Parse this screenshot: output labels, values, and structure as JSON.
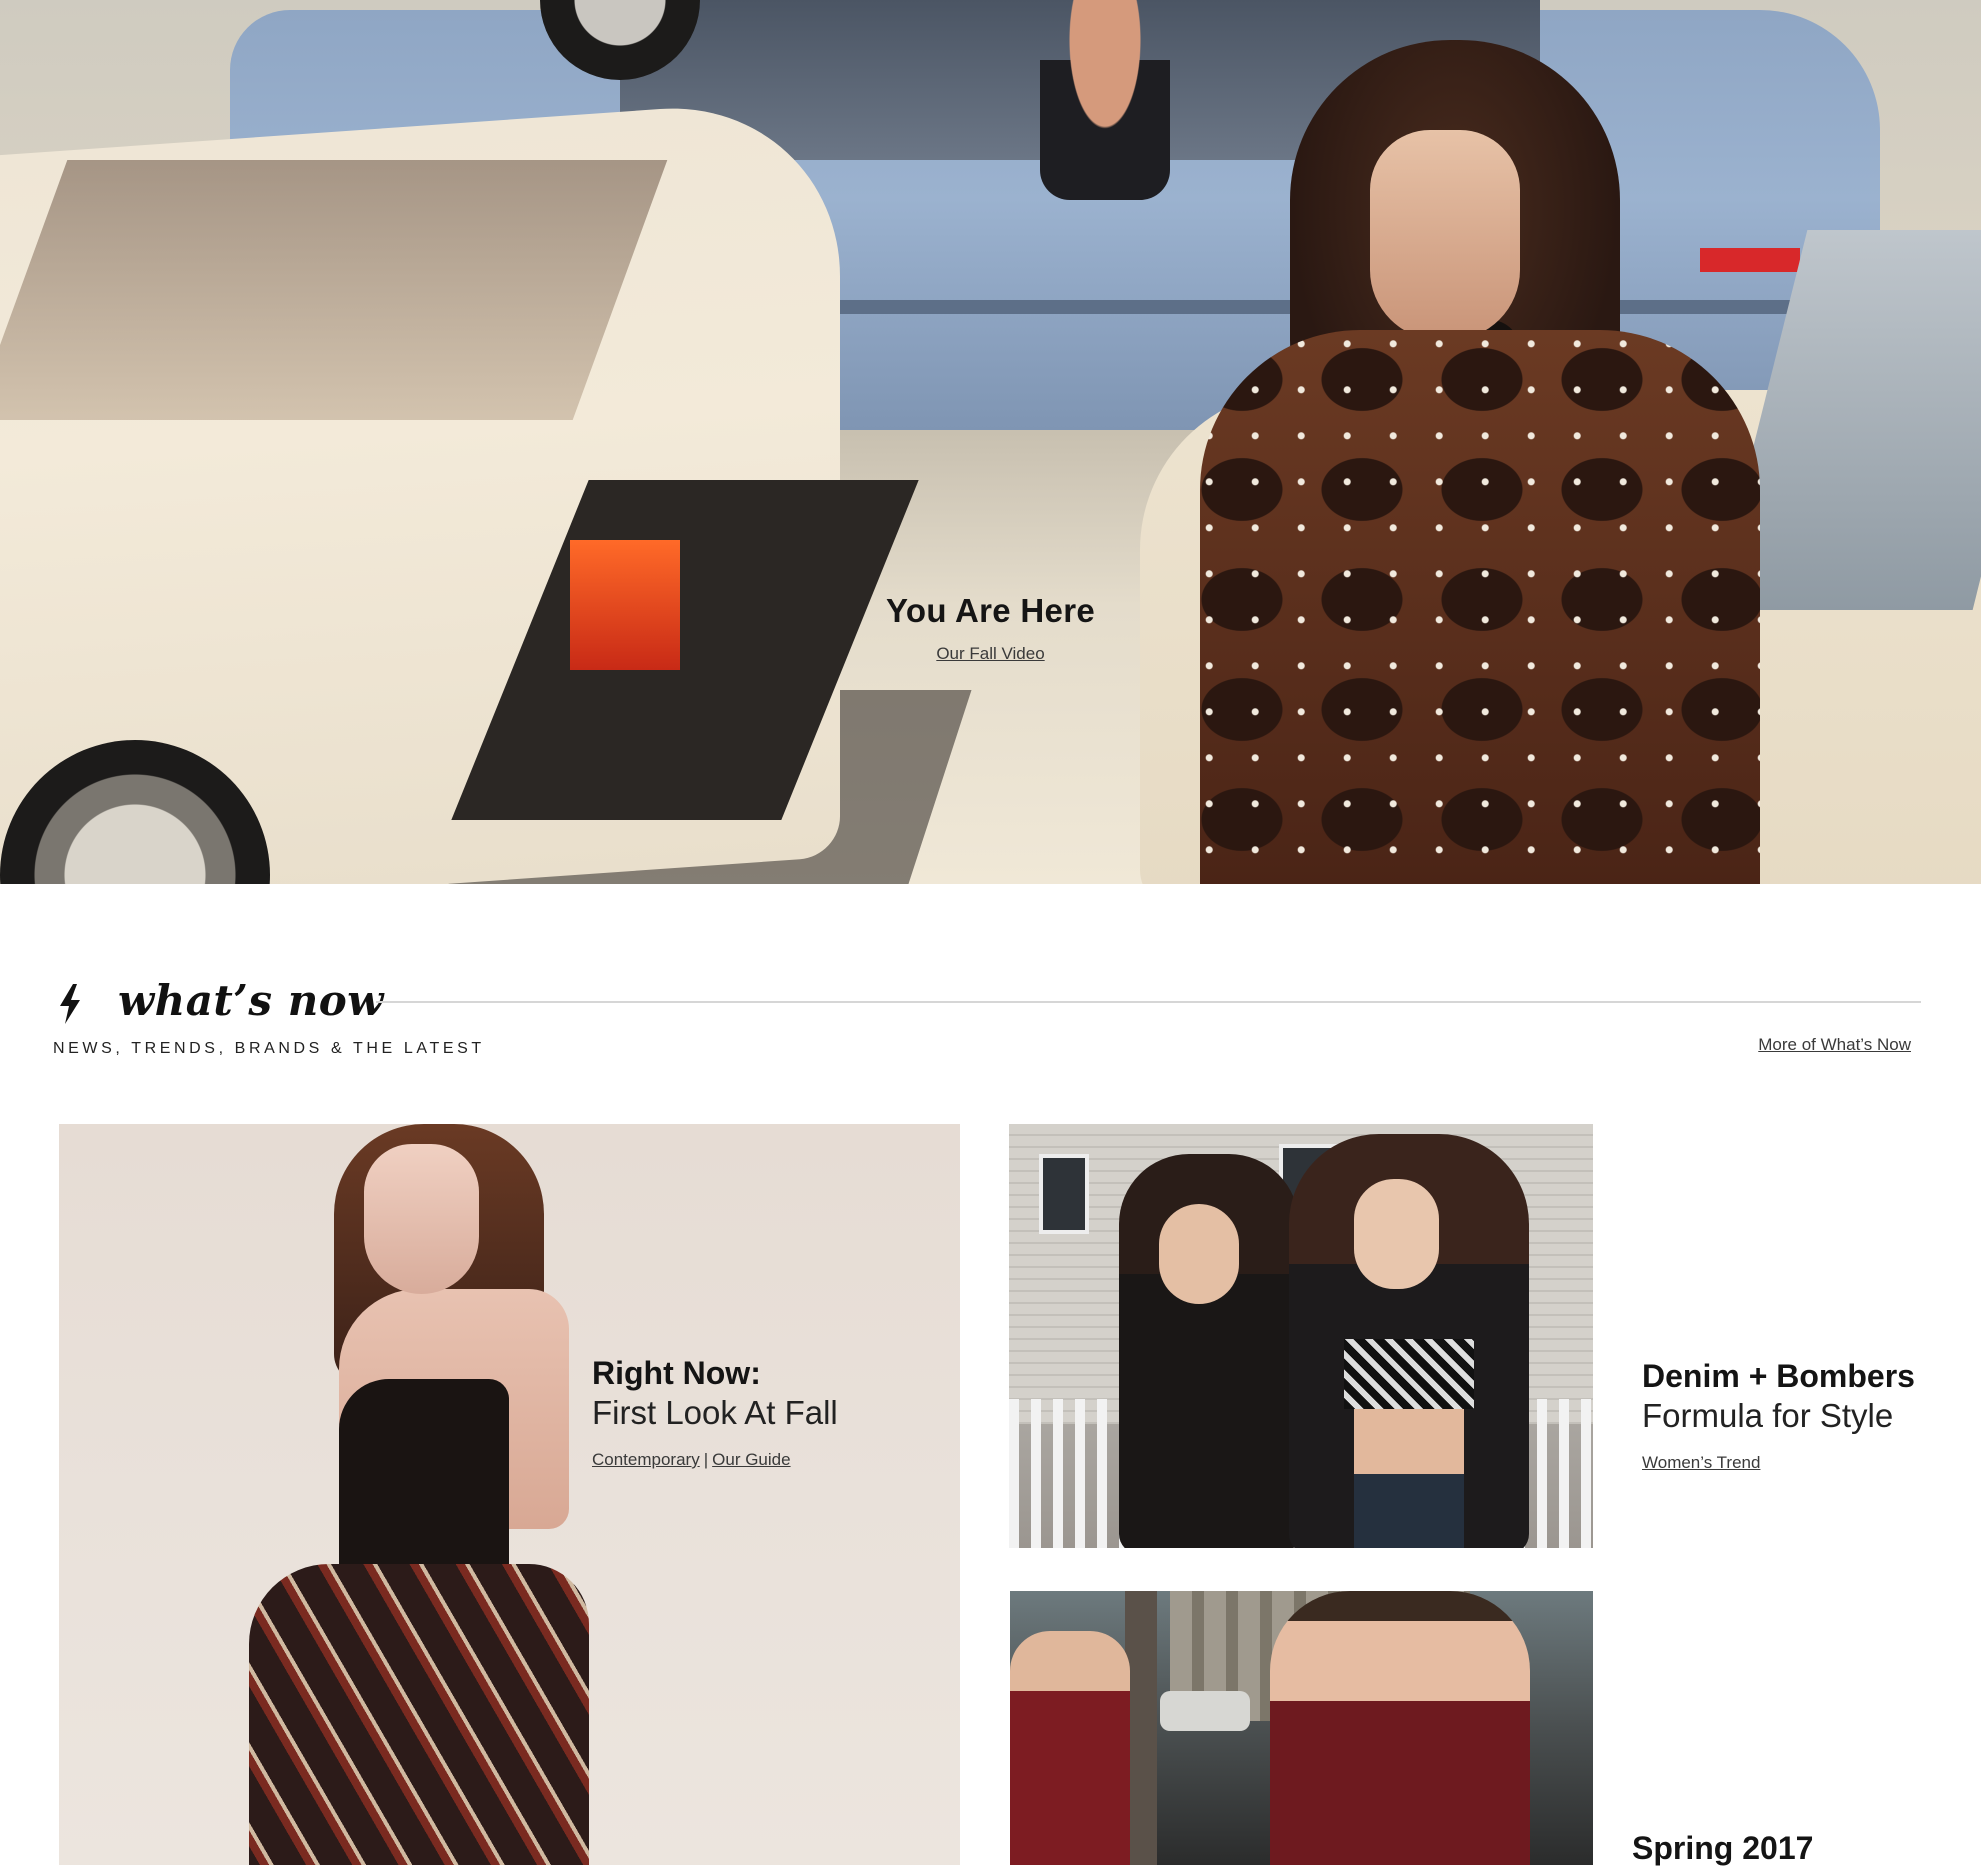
{
  "hero": {
    "title": "You Are Here",
    "link": "Our Fall Video"
  },
  "whats_now": {
    "title": "what’s now",
    "subtitle": "NEWS, TRENDS, BRANDS & THE LATEST",
    "more_link": "More of What’s Now"
  },
  "cards": [
    {
      "title_bold": "Right Now:",
      "title_light": "First Look At Fall",
      "links": [
        "Contemporary",
        "Our Guide"
      ],
      "separator": "|"
    },
    {
      "title_bold": "Denim + Bombers",
      "title_light": "Formula for Style",
      "links": [
        "Women’s Trend"
      ]
    },
    {
      "title_bold": "Spring 2017"
    }
  ],
  "icons": {
    "bolt": "lightning-bolt-icon"
  },
  "colors": {
    "text": "#111111",
    "link": "#3a3a3a",
    "rule": "#d6d6d6",
    "background": "#ffffff"
  }
}
